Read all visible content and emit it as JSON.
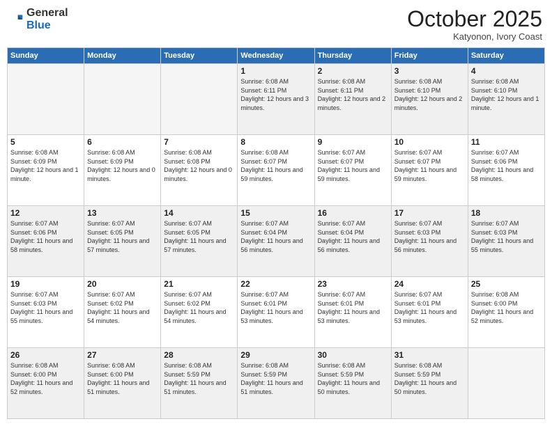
{
  "header": {
    "logo_general": "General",
    "logo_blue": "Blue",
    "month_year": "October 2025",
    "location": "Katyonon, Ivory Coast"
  },
  "weekdays": [
    "Sunday",
    "Monday",
    "Tuesday",
    "Wednesday",
    "Thursday",
    "Friday",
    "Saturday"
  ],
  "days": {
    "1": {
      "sunrise": "6:08 AM",
      "sunset": "6:11 PM",
      "daylight": "12 hours and 3 minutes."
    },
    "2": {
      "sunrise": "6:08 AM",
      "sunset": "6:11 PM",
      "daylight": "12 hours and 2 minutes."
    },
    "3": {
      "sunrise": "6:08 AM",
      "sunset": "6:10 PM",
      "daylight": "12 hours and 2 minutes."
    },
    "4": {
      "sunrise": "6:08 AM",
      "sunset": "6:10 PM",
      "daylight": "12 hours and 1 minute."
    },
    "5": {
      "sunrise": "6:08 AM",
      "sunset": "6:09 PM",
      "daylight": "12 hours and 1 minute."
    },
    "6": {
      "sunrise": "6:08 AM",
      "sunset": "6:09 PM",
      "daylight": "12 hours and 0 minutes."
    },
    "7": {
      "sunrise": "6:08 AM",
      "sunset": "6:08 PM",
      "daylight": "12 hours and 0 minutes."
    },
    "8": {
      "sunrise": "6:08 AM",
      "sunset": "6:07 PM",
      "daylight": "11 hours and 59 minutes."
    },
    "9": {
      "sunrise": "6:07 AM",
      "sunset": "6:07 PM",
      "daylight": "11 hours and 59 minutes."
    },
    "10": {
      "sunrise": "6:07 AM",
      "sunset": "6:07 PM",
      "daylight": "11 hours and 59 minutes."
    },
    "11": {
      "sunrise": "6:07 AM",
      "sunset": "6:06 PM",
      "daylight": "11 hours and 58 minutes."
    },
    "12": {
      "sunrise": "6:07 AM",
      "sunset": "6:06 PM",
      "daylight": "11 hours and 58 minutes."
    },
    "13": {
      "sunrise": "6:07 AM",
      "sunset": "6:05 PM",
      "daylight": "11 hours and 57 minutes."
    },
    "14": {
      "sunrise": "6:07 AM",
      "sunset": "6:05 PM",
      "daylight": "11 hours and 57 minutes."
    },
    "15": {
      "sunrise": "6:07 AM",
      "sunset": "6:04 PM",
      "daylight": "11 hours and 56 minutes."
    },
    "16": {
      "sunrise": "6:07 AM",
      "sunset": "6:04 PM",
      "daylight": "11 hours and 56 minutes."
    },
    "17": {
      "sunrise": "6:07 AM",
      "sunset": "6:03 PM",
      "daylight": "11 hours and 56 minutes."
    },
    "18": {
      "sunrise": "6:07 AM",
      "sunset": "6:03 PM",
      "daylight": "11 hours and 55 minutes."
    },
    "19": {
      "sunrise": "6:07 AM",
      "sunset": "6:03 PM",
      "daylight": "11 hours and 55 minutes."
    },
    "20": {
      "sunrise": "6:07 AM",
      "sunset": "6:02 PM",
      "daylight": "11 hours and 54 minutes."
    },
    "21": {
      "sunrise": "6:07 AM",
      "sunset": "6:02 PM",
      "daylight": "11 hours and 54 minutes."
    },
    "22": {
      "sunrise": "6:07 AM",
      "sunset": "6:01 PM",
      "daylight": "11 hours and 53 minutes."
    },
    "23": {
      "sunrise": "6:07 AM",
      "sunset": "6:01 PM",
      "daylight": "11 hours and 53 minutes."
    },
    "24": {
      "sunrise": "6:07 AM",
      "sunset": "6:01 PM",
      "daylight": "11 hours and 53 minutes."
    },
    "25": {
      "sunrise": "6:08 AM",
      "sunset": "6:00 PM",
      "daylight": "11 hours and 52 minutes."
    },
    "26": {
      "sunrise": "6:08 AM",
      "sunset": "6:00 PM",
      "daylight": "11 hours and 52 minutes."
    },
    "27": {
      "sunrise": "6:08 AM",
      "sunset": "6:00 PM",
      "daylight": "11 hours and 51 minutes."
    },
    "28": {
      "sunrise": "6:08 AM",
      "sunset": "5:59 PM",
      "daylight": "11 hours and 51 minutes."
    },
    "29": {
      "sunrise": "6:08 AM",
      "sunset": "5:59 PM",
      "daylight": "11 hours and 51 minutes."
    },
    "30": {
      "sunrise": "6:08 AM",
      "sunset": "5:59 PM",
      "daylight": "11 hours and 50 minutes."
    },
    "31": {
      "sunrise": "6:08 AM",
      "sunset": "5:59 PM",
      "daylight": "11 hours and 50 minutes."
    }
  }
}
